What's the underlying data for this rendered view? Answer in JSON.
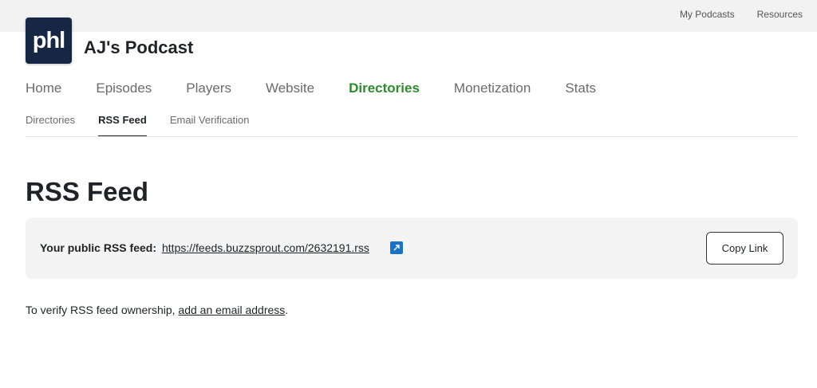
{
  "top_links": {
    "my_podcasts": "My Podcasts",
    "resources": "Resources"
  },
  "logo": {
    "text": "phl"
  },
  "podcast": {
    "title": "AJ's Podcast"
  },
  "main_nav": {
    "items": [
      {
        "label": "Home"
      },
      {
        "label": "Episodes"
      },
      {
        "label": "Players"
      },
      {
        "label": "Website"
      },
      {
        "label": "Directories"
      },
      {
        "label": "Monetization"
      },
      {
        "label": "Stats"
      }
    ],
    "active_color": "#2e8b2e"
  },
  "sub_nav": {
    "items": [
      {
        "label": "Directories"
      },
      {
        "label": "RSS Feed"
      },
      {
        "label": "Email Verification"
      }
    ]
  },
  "page": {
    "title": "RSS Feed"
  },
  "feed": {
    "label": "Your public RSS feed:",
    "url": "https://feeds.buzzsprout.com/2632191.rss",
    "copy_label": "Copy Link",
    "icon": "external-link-icon"
  },
  "verify": {
    "prefix": "To verify RSS feed ownership, ",
    "link": "add an email address",
    "suffix": "."
  }
}
